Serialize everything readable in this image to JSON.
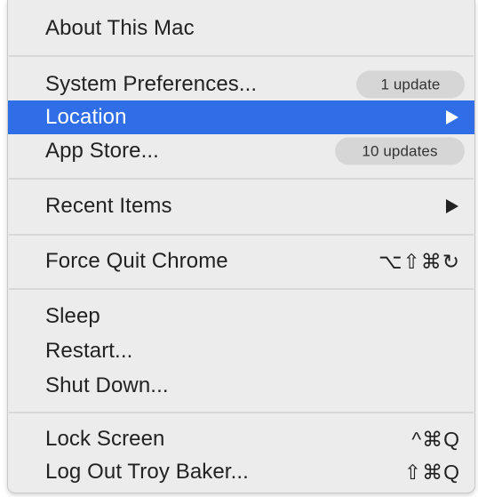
{
  "menu": {
    "items": {
      "about": {
        "label": "About This Mac"
      },
      "system_preferences": {
        "label": "System Preferences...",
        "badge": "1 update"
      },
      "location": {
        "label": "Location"
      },
      "app_store": {
        "label": "App Store...",
        "badge": "10 updates"
      },
      "recent_items": {
        "label": "Recent Items"
      },
      "force_quit": {
        "label": "Force Quit Chrome",
        "shortcut": "⌥⇧⌘↻"
      },
      "sleep": {
        "label": "Sleep"
      },
      "restart": {
        "label": "Restart..."
      },
      "shut_down": {
        "label": "Shut Down..."
      },
      "lock_screen": {
        "label": "Lock Screen",
        "shortcut": "^⌘Q"
      },
      "log_out": {
        "label": "Log Out Troy Baker...",
        "shortcut": "⇧⌘Q"
      }
    },
    "highlighted_item": "Location",
    "highlight_color": "#2f6ee6",
    "background_color": "#ececec"
  }
}
